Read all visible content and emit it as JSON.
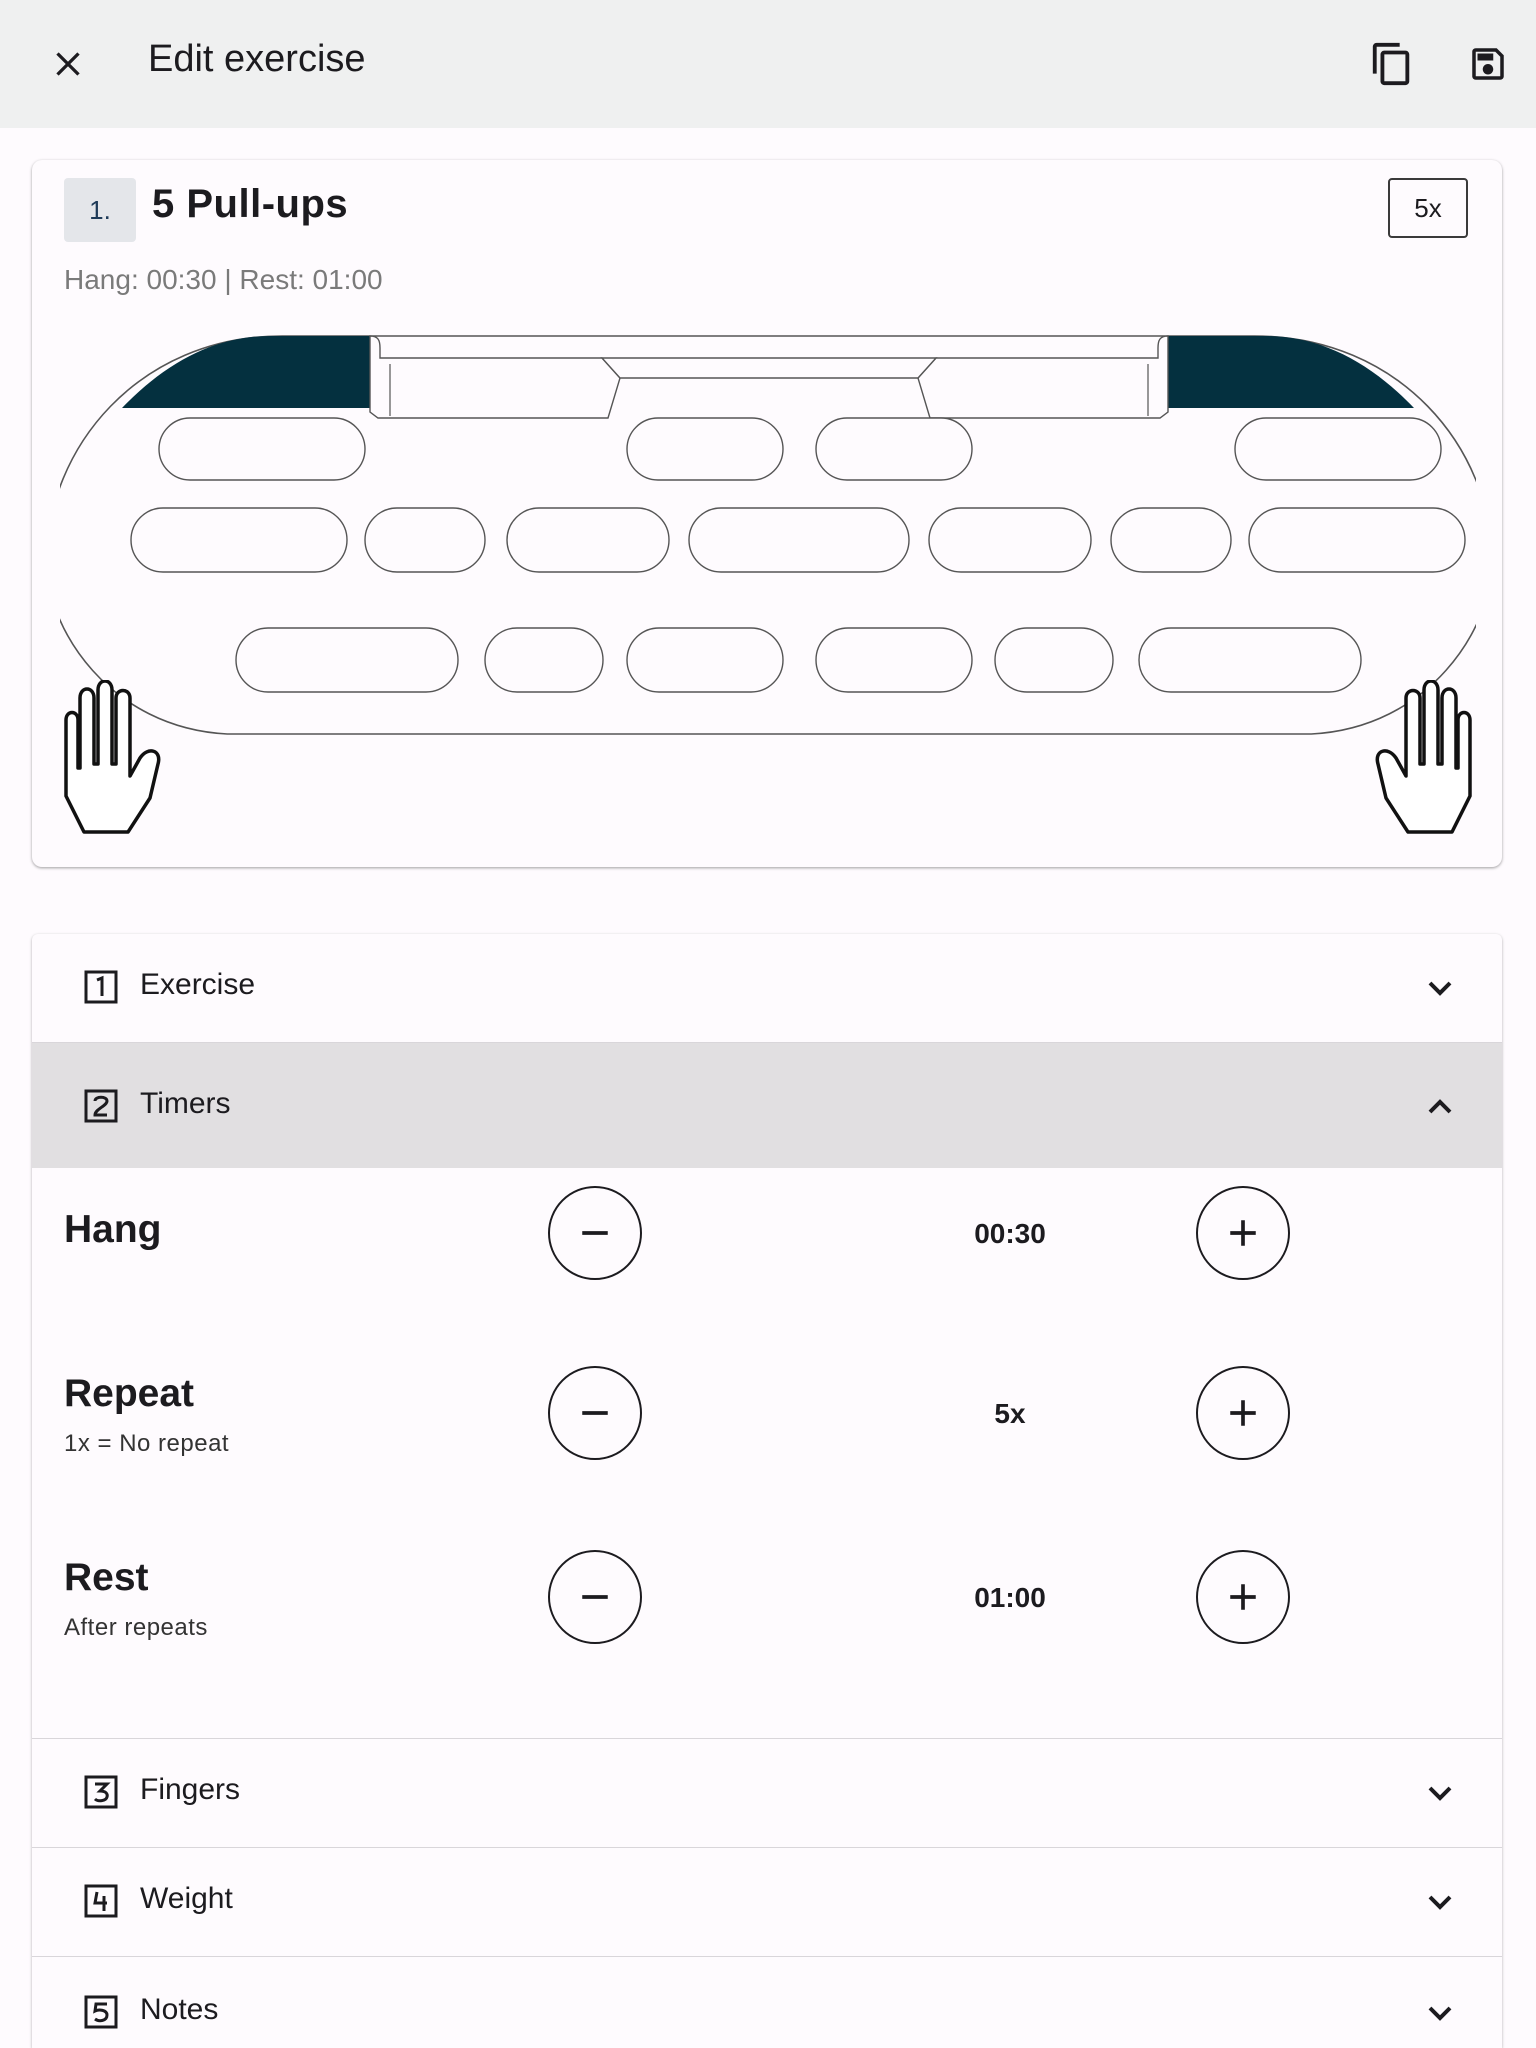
{
  "header": {
    "title": "Edit exercise",
    "close_icon": "close-icon",
    "copy_icon": "copy-icon",
    "save_icon": "save-icon"
  },
  "exercise_card": {
    "number": "1.",
    "name": "5  Pull-ups",
    "repeat_badge": "5x",
    "summary": "Hang: 00:30 | Rest: 01:00",
    "highlight_color": "#04303f",
    "hand_icon": "hand-icon"
  },
  "sections": {
    "exercise": {
      "number_icon": "number-1-icon",
      "label": "Exercise",
      "chevron": "chevron-down-icon"
    },
    "timers": {
      "number_icon": "number-2-icon",
      "label": "Timers",
      "chevron": "chevron-up-icon",
      "expanded": true,
      "header_color": "#e1dfe1"
    },
    "fingers": {
      "number_icon": "number-3-icon",
      "label": "Fingers",
      "chevron": "chevron-down-icon"
    },
    "weight": {
      "number_icon": "number-4-icon",
      "label": "Weight",
      "chevron": "chevron-down-icon"
    },
    "notes": {
      "number_icon": "number-5-icon",
      "label": "Notes",
      "chevron": "chevron-down-icon"
    }
  },
  "timers": {
    "hang": {
      "title": "Hang",
      "value": "00:30"
    },
    "repeat": {
      "title": "Repeat",
      "subtitle": "1x = No repeat",
      "value": "5x"
    },
    "rest": {
      "title": "Rest",
      "subtitle": "After repeats",
      "value": "01:00"
    }
  }
}
